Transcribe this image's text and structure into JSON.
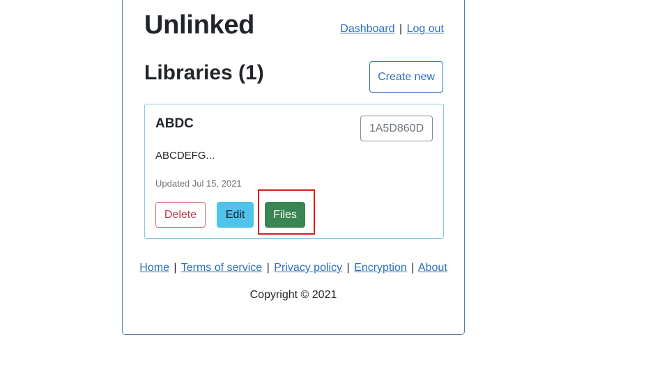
{
  "header": {
    "app_title": "Unlinked",
    "nav_links": [
      {
        "label": "Dashboard"
      },
      {
        "label": "Log out"
      }
    ],
    "separator": "|"
  },
  "libraries": {
    "title": "Libraries (1)",
    "create_button_label": "Create new",
    "items": [
      {
        "name": "ABDC",
        "id_badge": "1A5D860D",
        "description": "ABCDEFG...",
        "updated": "Updated Jul 15, 2021",
        "actions": {
          "delete_label": "Delete",
          "edit_label": "Edit",
          "files_label": "Files"
        }
      }
    ]
  },
  "footer": {
    "links": [
      {
        "label": "Home"
      },
      {
        "label": "Terms of service"
      },
      {
        "label": "Privacy policy"
      },
      {
        "label": "Encryption"
      },
      {
        "label": "About"
      }
    ],
    "separator": "|",
    "copyright": "Copyright © 2021"
  },
  "colors": {
    "link": "#2c6fbe",
    "delete": "#c0394a",
    "edit": "#4fc3ea",
    "files": "#3a8554",
    "highlight": "#e01a1a"
  }
}
